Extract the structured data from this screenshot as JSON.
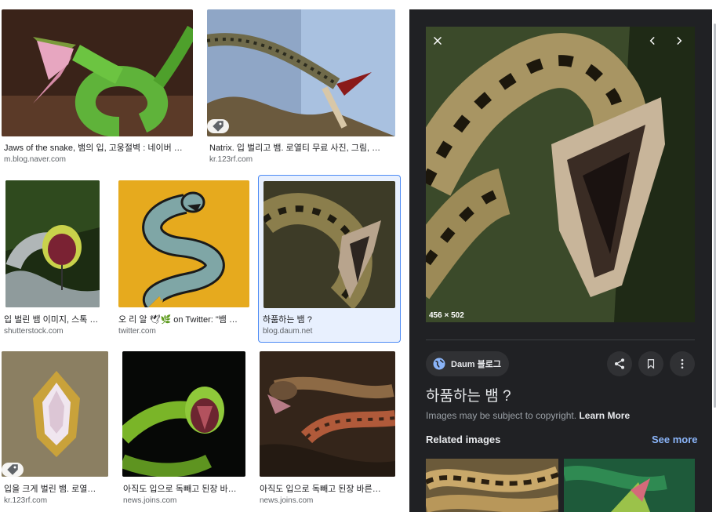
{
  "results": [
    {
      "title": "Jaws of the snake, 뱀의 입, 고웅절벽 : 네이버 …",
      "source": "m.blog.naver.com"
    },
    {
      "title": "Natrix. 입 벌리고 뱀. 로열티 무료 사진, 그림, …",
      "source": "kr.123rf.com"
    },
    {
      "title": "입 벌린 뱀 이미지, 스톡 …",
      "source": "shutterstock.com"
    },
    {
      "title": "오 리 알 🕊🌿 on Twitter: \"뱀 입…",
      "source": "twitter.com"
    },
    {
      "title": "하품하는 뱀 ?",
      "source": "blog.daum.net"
    },
    {
      "title": "입을 크게 벌린 뱀. 로열…",
      "source": "kr.123rf.com"
    },
    {
      "title": "아직도 입으로 독빼고 된장 바…",
      "source": "news.joins.com"
    },
    {
      "title": "아직도 입으로 독빼고 된장 바른…",
      "source": "news.joins.com"
    }
  ],
  "preview": {
    "dimensions": "456 × 502",
    "source_name": "Daum 블로그",
    "title": "하품하는 뱀 ?",
    "copyright_text": "Images may be subject to copyright.",
    "learn_more": "Learn More",
    "related_heading": "Related images",
    "see_more": "See more"
  },
  "colors": {
    "panel_bg": "#202124",
    "accent_link": "#8ab4f8",
    "selected_border": "#4c8bf5"
  },
  "icons": [
    "close-icon",
    "chevron-left-icon",
    "chevron-right-icon",
    "globe-icon",
    "share-icon",
    "bookmark-icon",
    "more-vert-icon",
    "tag-icon"
  ]
}
